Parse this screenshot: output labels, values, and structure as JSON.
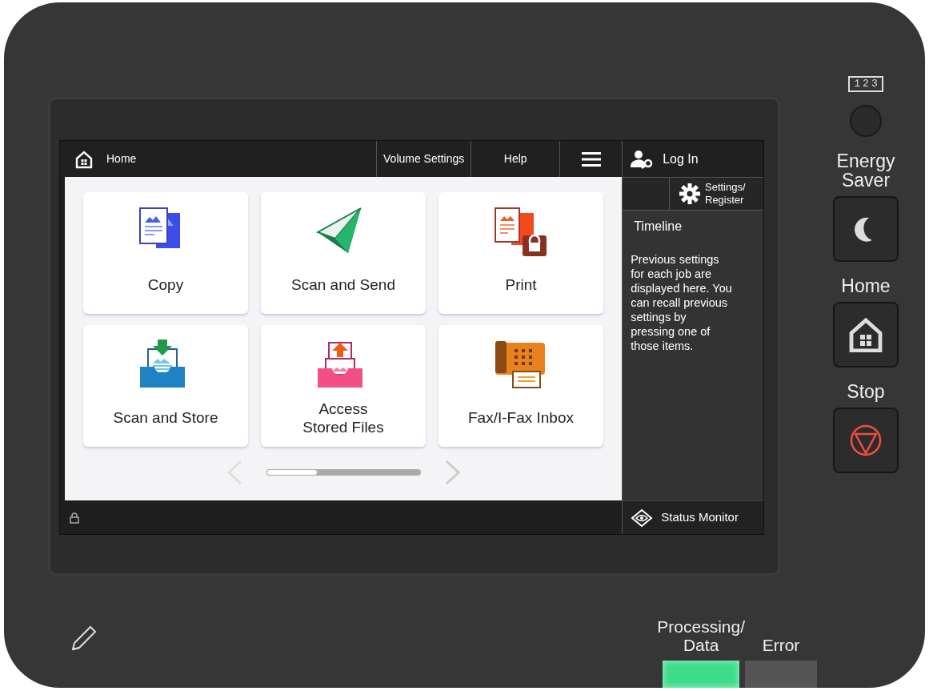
{
  "screen": {
    "top_bar": {
      "home_label": "Home",
      "buttons": [
        "Volume Settings",
        "Help"
      ]
    },
    "tiles": [
      {
        "kind": "copy",
        "lines": [
          "Copy"
        ]
      },
      {
        "kind": "send",
        "lines": [
          "Scan and Send"
        ]
      },
      {
        "kind": "print",
        "lines": [
          "Print"
        ]
      },
      {
        "kind": "store",
        "lines": [
          "Scan and Store"
        ]
      },
      {
        "kind": "access",
        "lines": [
          "Access",
          "Stored Files"
        ]
      },
      {
        "kind": "fax",
        "lines": [
          "Fax/I-Fax Inbox"
        ]
      }
    ],
    "pager": {
      "level": 0.33
    },
    "sidebar": {
      "login": "Log In",
      "settings_lines": [
        "Settings/",
        "Register"
      ],
      "timeline_title": "Timeline",
      "timeline_text": "Previous settings for each job are displayed here. You can recall previous settings by pressing one of those items.",
      "status_monitor": "Status Monitor"
    }
  },
  "hardware": {
    "counter_label": "123",
    "keys": [
      {
        "kind": "energy",
        "lines": [
          "Energy",
          "Saver"
        ]
      },
      {
        "kind": "home",
        "lines": [
          "Home"
        ]
      },
      {
        "kind": "stop",
        "lines": [
          "Stop"
        ]
      }
    ],
    "lamps": [
      {
        "lines": [
          "Processing/",
          "Data"
        ],
        "on": true
      },
      {
        "lines": [
          "Error"
        ],
        "on": false
      }
    ]
  }
}
